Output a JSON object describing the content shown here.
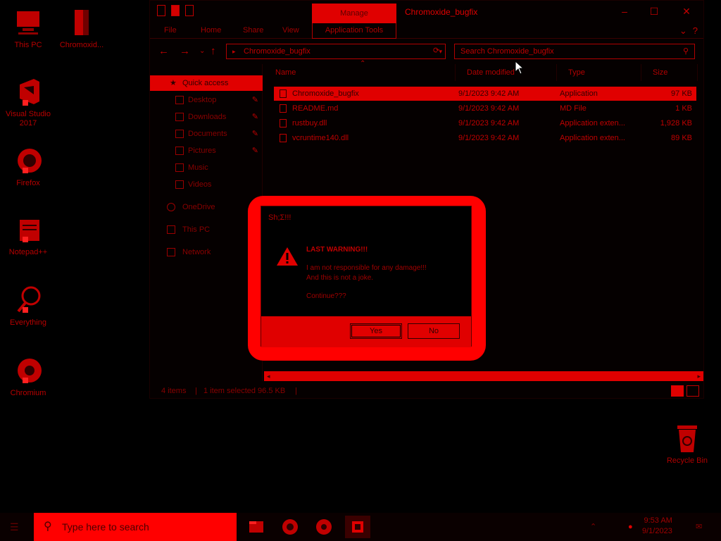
{
  "colors": {
    "accent": "#ff0000",
    "dark": "#000000",
    "text": "#e00000"
  },
  "desktop": {
    "icons": [
      {
        "label": "This PC",
        "icon": "computer-icon"
      },
      {
        "label": "Chromoxid...",
        "icon": "folder-icon"
      },
      {
        "label": "Visual Studio 2017",
        "icon": "visual-studio-icon"
      },
      {
        "label": "Firefox",
        "icon": "firefox-icon"
      },
      {
        "label": "Notepad++",
        "icon": "notepad-plus-icon"
      },
      {
        "label": "Everything",
        "icon": "everything-search-icon"
      },
      {
        "label": "Chromium",
        "icon": "chromium-icon"
      }
    ],
    "recycle_bin": {
      "label": "Recycle Bin",
      "icon": "recycle-bin-icon"
    }
  },
  "explorer": {
    "title": "Chromoxide_bugfix",
    "manage_tab": "Manage",
    "ribbon_tabs": [
      "File",
      "Home",
      "Share",
      "View"
    ],
    "app_tools_tab": "Application Tools",
    "address": "Chromoxide_bugfix",
    "search_placeholder": "Search Chromoxide_bugfix",
    "nav_items": [
      {
        "label": "Quick access",
        "icon": "star-icon",
        "pinned": false,
        "active": true
      },
      {
        "label": "Desktop",
        "icon": "desktop-icon",
        "pinned": true
      },
      {
        "label": "Downloads",
        "icon": "download-icon",
        "pinned": true
      },
      {
        "label": "Documents",
        "icon": "documents-icon",
        "pinned": true
      },
      {
        "label": "Pictures",
        "icon": "pictures-icon",
        "pinned": true
      },
      {
        "label": "Music",
        "icon": "music-icon",
        "pinned": false
      },
      {
        "label": "Videos",
        "icon": "videos-icon",
        "pinned": false
      },
      {
        "label": "OneDrive",
        "icon": "cloud-icon",
        "pinned": false
      },
      {
        "label": "This PC",
        "icon": "computer-icon",
        "pinned": false
      },
      {
        "label": "Network",
        "icon": "network-icon",
        "pinned": false
      }
    ],
    "columns": [
      "Name",
      "Date modified",
      "Type",
      "Size"
    ],
    "files": [
      {
        "name": "Chromoxide_bugfix",
        "date": "9/1/2023 9:42 AM",
        "type": "Application",
        "size": "97 KB",
        "selected": true
      },
      {
        "name": "README.md",
        "date": "9/1/2023 9:42 AM",
        "type": "MD File",
        "size": "1 KB",
        "selected": false
      },
      {
        "name": "rustbuy.dll",
        "date": "9/1/2023 9:42 AM",
        "type": "Application exten...",
        "size": "1,928 KB",
        "selected": false
      },
      {
        "name": "vcruntime140.dll",
        "date": "9/1/2023 9:42 AM",
        "type": "Application exten...",
        "size": "89 KB",
        "selected": false
      }
    ],
    "status_items": "4 items",
    "status_selected": "1 item selected  96.5 KB"
  },
  "dialog": {
    "title": "Sh;Σ!!!",
    "heading": "LAST WARNING!!!",
    "line1": "I am not responsible for any damage!!!",
    "line2": "And this is not a joke.",
    "line3": "Continue???",
    "yes_label": "Yes",
    "no_label": "No"
  },
  "taskbar": {
    "search_placeholder": "Type here to search",
    "apps": [
      "file-explorer-icon",
      "firefox-icon",
      "chromium-icon",
      "chromoxide-app-icon"
    ],
    "time": "9:53 AM",
    "date": "9/1/2023"
  }
}
